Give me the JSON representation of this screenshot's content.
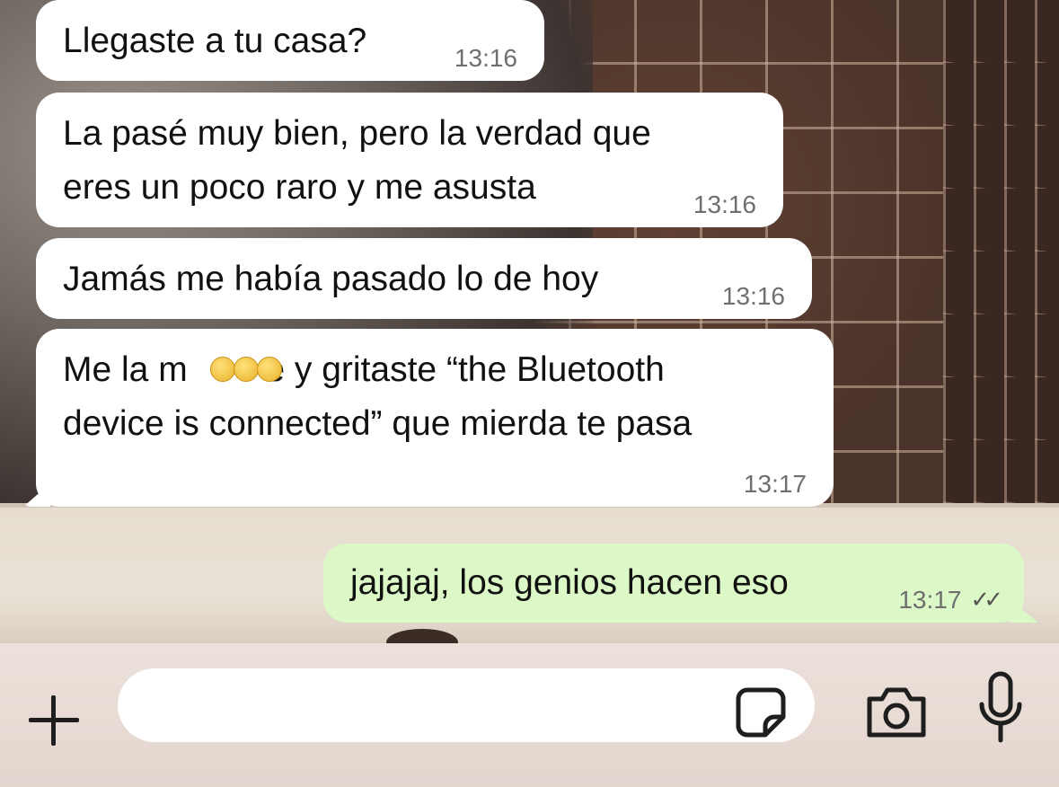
{
  "chat": {
    "messages": [
      {
        "direction": "incoming",
        "lines": [
          "Llegaste a tu casa?"
        ],
        "time": "13:16"
      },
      {
        "direction": "incoming",
        "lines": [
          "La pasé muy bien, pero la verdad que",
          "eres un poco raro y me asusta"
        ],
        "time": "13:16"
      },
      {
        "direction": "incoming",
        "lines": [
          "Jamás me había pasado lo de hoy"
        ],
        "time": "13:16"
      },
      {
        "direction": "incoming",
        "lines": [
          "Me la m        e y gritaste “the Bluetooth",
          "device is connected” que mierda te pasa"
        ],
        "time": "13:17",
        "emoji_overlay": "upside-down-face-icon x3"
      },
      {
        "direction": "outgoing",
        "lines": [
          "jajajaj, los genios hacen eso"
        ],
        "time": "13:17",
        "status": "read",
        "status_ticks": "✓✓"
      }
    ]
  },
  "input_bar": {
    "placeholder": "",
    "icons": [
      "plus-icon",
      "sticker-icon",
      "camera-icon",
      "microphone-icon"
    ]
  },
  "colors": {
    "incoming_bubble": "#ffffff",
    "outgoing_bubble": "#dcf8c6",
    "timestamp": "#6f6f6f",
    "input_bar_bg": "#e8ddd6"
  }
}
